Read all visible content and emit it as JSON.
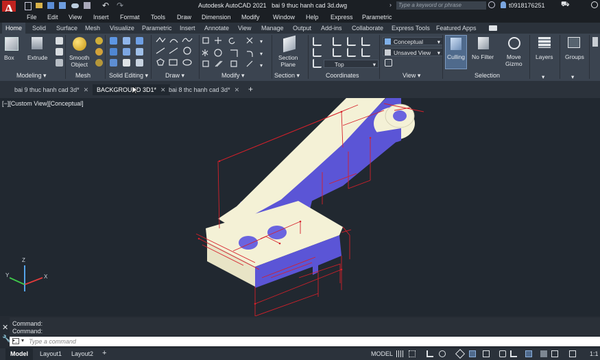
{
  "window": {
    "title": "Autodesk AutoCAD 2021",
    "file": "bai 9 thuc hanh cad 3d.dwg",
    "search_placeholder": "Type a keyword or phrase",
    "user": "t0918176251",
    "app_letter": "A"
  },
  "menu": [
    "File",
    "Edit",
    "View",
    "Insert",
    "Format",
    "Tools",
    "Draw",
    "Dimension",
    "Modify",
    "Window",
    "Help",
    "Express",
    "Parametric"
  ],
  "ribbon_tabs": [
    "Home",
    "Solid",
    "Surface",
    "Mesh",
    "Visualize",
    "Parametric",
    "Insert",
    "Annotate",
    "View",
    "Manage",
    "Output",
    "Add-ins",
    "Collaborate",
    "Express Tools",
    "Featured Apps"
  ],
  "active_ribbon_tab": "Home",
  "panels": {
    "modeling": {
      "label": "Modeling",
      "box": "Box",
      "extrude": "Extrude"
    },
    "mesh": {
      "label": "Mesh",
      "smooth_object_1": "Smooth",
      "smooth_object_2": "Object"
    },
    "solid_editing": {
      "label": "Solid Editing"
    },
    "draw": {
      "label": "Draw"
    },
    "modify": {
      "label": "Modify"
    },
    "section": {
      "label": "Section",
      "section_plane_1": "Section",
      "section_plane_2": "Plane"
    },
    "coordinates": {
      "label": "Coordinates",
      "ucs_value": "Top"
    },
    "view": {
      "label": "View",
      "visual_style": "Conceptual",
      "saved_view": "Unsaved View"
    },
    "selection": {
      "label": "Selection",
      "culling": "Culling",
      "no_filter": "No Filter",
      "move_gizmo_1": "Move",
      "move_gizmo_2": "Gizmo"
    },
    "layers": {
      "label": "Layers"
    },
    "groups": {
      "label": "Groups"
    }
  },
  "doc_tabs": [
    {
      "label": "bai 9 thuc hanh cad 3d*",
      "active": false
    },
    {
      "label": "BACKGROUND 3D1*",
      "active": true
    },
    {
      "label": "bai 8 thc hanh cad 3d*",
      "active": false
    }
  ],
  "viewport": {
    "controls": "[−][Custom View][Conceptual]",
    "axes": {
      "x": "X",
      "y": "Y",
      "z": "Z"
    },
    "colors": {
      "solid_face": "#f4f1d6",
      "solid_shadow": "#5b55d6",
      "dimension": "#d6202a",
      "background": "#212830"
    }
  },
  "command": {
    "history": [
      "Command:",
      "Command:"
    ],
    "prompt_placeholder": "Type a command"
  },
  "status": {
    "layout_tabs": [
      "Model",
      "Layout1",
      "Layout2"
    ],
    "active_layout": "Model",
    "mode": "MODEL",
    "scale": "1:1"
  }
}
